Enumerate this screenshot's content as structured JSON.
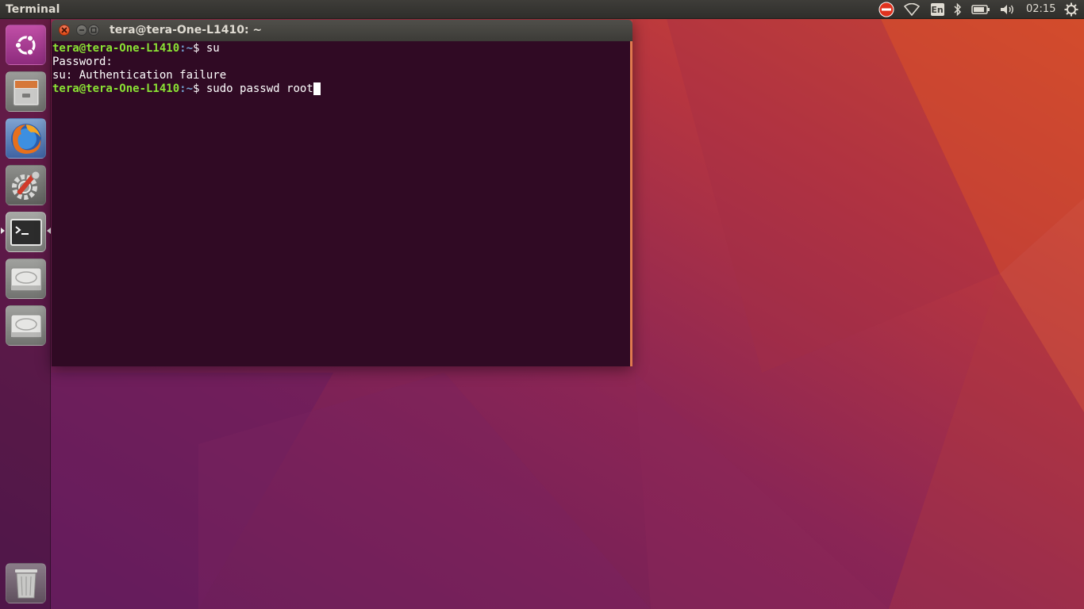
{
  "top_panel": {
    "app_name": "Terminal",
    "language": "En",
    "clock": "02:15",
    "icons": [
      "do-not-disturb-icon",
      "wifi-icon",
      "keyboard-language-icon",
      "bluetooth-icon",
      "battery-icon",
      "volume-icon",
      "power-gear-icon"
    ]
  },
  "launcher": {
    "items": [
      {
        "name": "ubuntu-dash",
        "icon": "ubuntu-logo-icon"
      },
      {
        "name": "files",
        "icon": "file-cabinet-icon"
      },
      {
        "name": "firefox",
        "icon": "firefox-icon"
      },
      {
        "name": "system-settings",
        "icon": "settings-wrench-icon"
      },
      {
        "name": "terminal",
        "icon": "terminal-icon",
        "active": true
      },
      {
        "name": "drive-1",
        "icon": "hard-drive-icon"
      },
      {
        "name": "drive-2",
        "icon": "hard-drive-icon"
      },
      {
        "name": "trash",
        "icon": "trash-icon"
      }
    ]
  },
  "terminal": {
    "title": "tera@tera-One-L1410: ~",
    "lines": [
      {
        "user": "tera@tera-One-L1410",
        "path": ":~",
        "symbol": "$ ",
        "cmd": "su"
      },
      {
        "text": "Password:"
      },
      {
        "text": "su: Authentication failure"
      },
      {
        "user": "tera@tera-One-L1410",
        "path": ":~",
        "symbol": "$ ",
        "cmd": "sudo passwd root"
      }
    ]
  },
  "colors": {
    "terminal_bg": "#300a24",
    "prompt_user": "#8ae234",
    "prompt_path": "#729fcf",
    "panel_bg": "#3c3b37",
    "close_button": "#e95420"
  }
}
